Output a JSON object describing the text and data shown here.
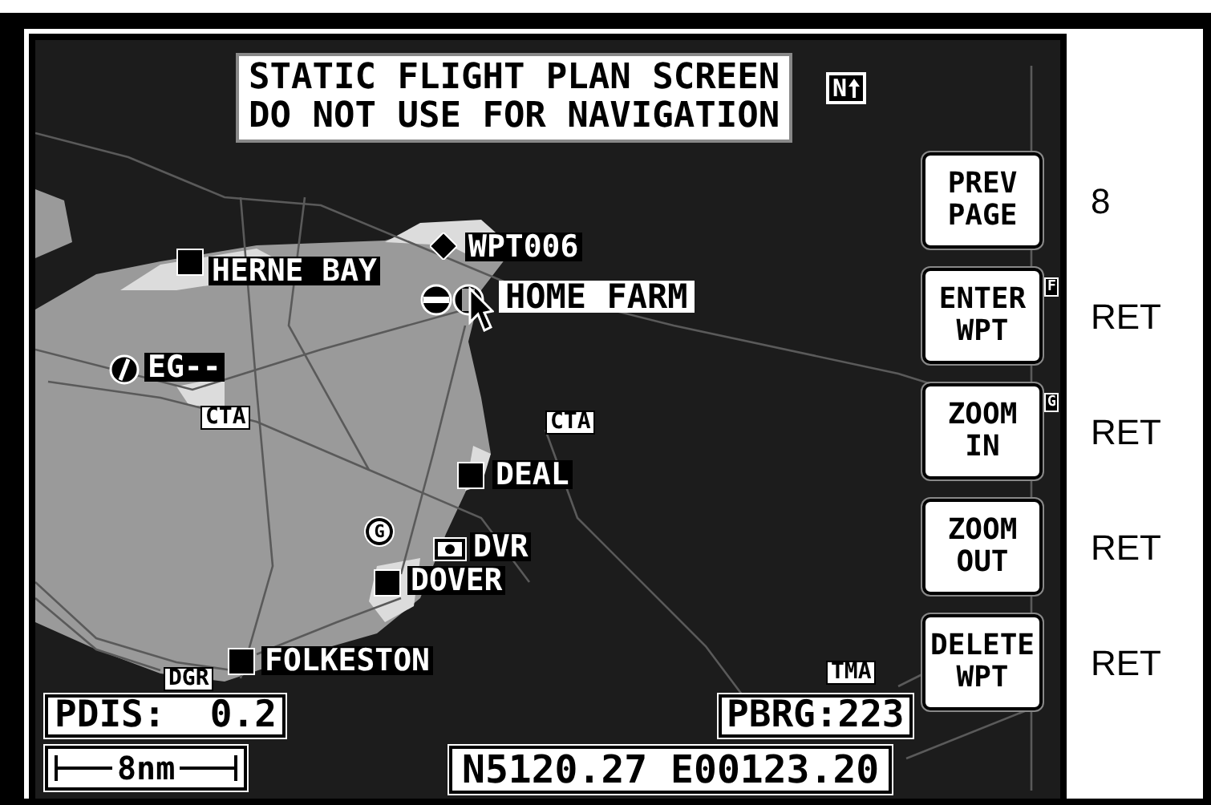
{
  "notice": {
    "lines": [
      "STATIC FLIGHT PLAN SCREEN",
      "DO NOT USE FOR NAVIGATION"
    ]
  },
  "orientation": "N",
  "map": {
    "places": [
      {
        "kind": "town",
        "label": "HERNE BAY",
        "selected": false
      },
      {
        "kind": "waypoint",
        "label": "WPT006",
        "selected": false
      },
      {
        "kind": "home",
        "label": "HOME FARM",
        "selected": true
      },
      {
        "kind": "airfield",
        "label": "EG--",
        "selected": false
      },
      {
        "kind": "town",
        "label": "DEAL",
        "selected": false
      },
      {
        "kind": "gliding",
        "label": "G",
        "selected": false
      },
      {
        "kind": "vor",
        "label": "DVR",
        "selected": false
      },
      {
        "kind": "town",
        "label": "DOVER",
        "selected": false
      },
      {
        "kind": "town",
        "label": "FOLKESTON",
        "selected": false
      }
    ],
    "airspace_labels": [
      "CTA",
      "CTA",
      "DGR",
      "TMA"
    ]
  },
  "readouts": {
    "pdis": "PDIS:  0.2",
    "pbrg": "PBRG:223",
    "scale": "8nm",
    "position": "N5120.27 E00123.20"
  },
  "softkeys": [
    {
      "label": [
        "PREV",
        "PAGE"
      ],
      "key": "8"
    },
    {
      "label": [
        "ENTER",
        "WPT"
      ],
      "key": "RET",
      "tag": "F"
    },
    {
      "label": [
        "ZOOM",
        "IN"
      ],
      "key": "RET",
      "tag": "G"
    },
    {
      "label": [
        "ZOOM",
        "OUT"
      ],
      "key": "RET"
    },
    {
      "label": [
        "DELETE",
        "WPT"
      ],
      "key": "RET"
    }
  ]
}
